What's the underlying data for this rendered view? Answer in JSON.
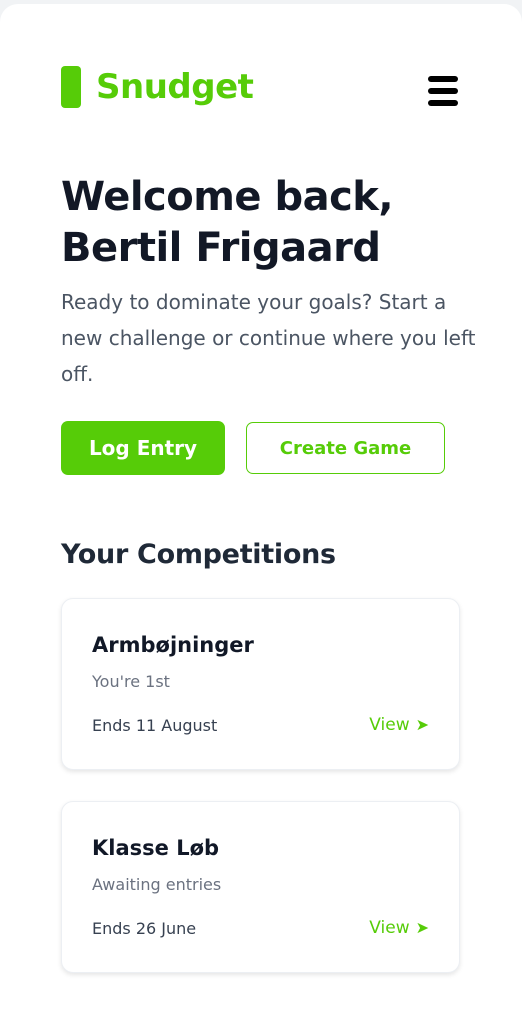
{
  "brand": {
    "name": "Snudget",
    "accent": "#56cc08"
  },
  "header": {
    "menu_icon": "hamburger-menu-icon"
  },
  "hero": {
    "title_line1": "Welcome back,",
    "title_line2": "Bertil Frigaard",
    "subtitle": "Ready to dominate your goals? Start a new challenge or continue where you left off."
  },
  "actions": {
    "log_entry_label": "Log Entry",
    "create_game_label": "Create Game"
  },
  "competitions": {
    "title": "Your Competitions",
    "items": [
      {
        "name": "Armbøjninger",
        "status": "You're 1st",
        "ends": "Ends 11 August",
        "view_label": "View",
        "view_icon": "arrow-right-icon"
      },
      {
        "name": "Klasse Løb",
        "status": "Awaiting entries",
        "ends": "Ends 26 June",
        "view_label": "View",
        "view_icon": "arrow-right-icon"
      }
    ]
  }
}
